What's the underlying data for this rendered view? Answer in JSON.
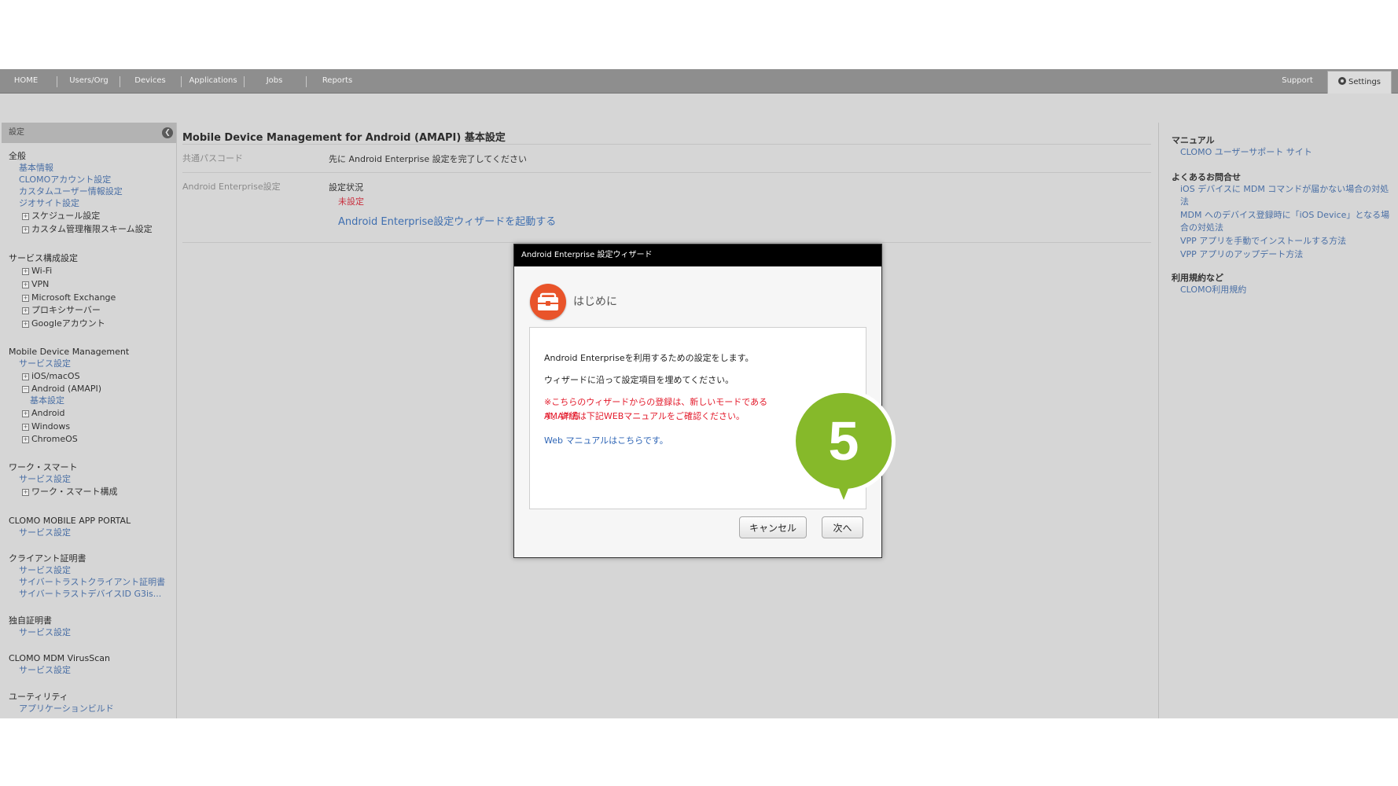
{
  "nav": {
    "items": [
      "HOME",
      "Users/Org",
      "Devices",
      "Applications",
      "Jobs",
      "Reports"
    ],
    "support": "Support",
    "settings": "Settings"
  },
  "sidebar": {
    "header": "設定",
    "sections": [
      {
        "title": "全般",
        "items": [
          {
            "label": "基本情報",
            "kind": "link"
          },
          {
            "label": "CLOMOアカウント設定",
            "kind": "link"
          },
          {
            "label": "カスタムユーザー情報設定",
            "kind": "link"
          },
          {
            "label": "ジオサイト設定",
            "kind": "link"
          },
          {
            "label": "スケジュール設定",
            "kind": "tree"
          },
          {
            "label": "カスタム管理権限スキーム設定",
            "kind": "tree"
          }
        ]
      },
      {
        "title": "サービス構成設定",
        "items": [
          {
            "label": "Wi-Fi",
            "kind": "tree"
          },
          {
            "label": "VPN",
            "kind": "tree"
          },
          {
            "label": "Microsoft Exchange",
            "kind": "tree"
          },
          {
            "label": "プロキシサーバー",
            "kind": "tree"
          },
          {
            "label": "Googleアカウント",
            "kind": "tree"
          }
        ]
      },
      {
        "title": "Mobile Device Management",
        "items": [
          {
            "label": "サービス設定",
            "kind": "link"
          },
          {
            "label": "iOS/macOS",
            "kind": "tree"
          },
          {
            "label": "Android (AMAPI)",
            "kind": "tree-open"
          },
          {
            "label": "基本設定",
            "kind": "sub"
          },
          {
            "label": "Android",
            "kind": "tree"
          },
          {
            "label": "Windows",
            "kind": "tree"
          },
          {
            "label": "ChromeOS",
            "kind": "tree"
          }
        ]
      },
      {
        "title": "ワーク・スマート",
        "items": [
          {
            "label": "サービス設定",
            "kind": "link"
          },
          {
            "label": "ワーク・スマート構成",
            "kind": "tree"
          }
        ]
      },
      {
        "title": "CLOMO MOBILE APP PORTAL",
        "items": [
          {
            "label": "サービス設定",
            "kind": "link"
          }
        ]
      },
      {
        "title": "クライアント証明書",
        "items": [
          {
            "label": "サービス設定",
            "kind": "link"
          },
          {
            "label": "サイバートラストクライアント証明書",
            "kind": "link"
          },
          {
            "label": "サイバートラストデバイスID G3is...",
            "kind": "link"
          }
        ]
      },
      {
        "title": "独自証明書",
        "items": [
          {
            "label": "サービス設定",
            "kind": "link"
          }
        ]
      },
      {
        "title": "CLOMO MDM VirusScan",
        "items": [
          {
            "label": "サービス設定",
            "kind": "link"
          }
        ]
      },
      {
        "title": "ユーティリティ",
        "items": [
          {
            "label": "アプリケーションビルド",
            "kind": "link"
          }
        ]
      }
    ]
  },
  "main": {
    "title": "Mobile Device Management for Android (AMAPI) 基本設定",
    "passcode_label": "共通パスコード",
    "passcode_value": "先に Android Enterprise 設定を完了してください",
    "ae_label": "Android Enterprise設定",
    "status_label": "設定状況",
    "status_value": "未設定",
    "wizard_link": "Android Enterprise設定ウィザードを起動する"
  },
  "right": {
    "manual_title": "マニュアル",
    "manual_link": "CLOMO ユーザーサポート サイト",
    "faq_title": "よくあるお問合せ",
    "faq_links": [
      "iOS デバイスに MDM コマンドが届かない場合の対処法",
      "MDM へのデバイス登録時に「iOS Device」となる場合の対処法",
      "VPP アプリを手動でインストールする方法",
      "VPP アプリのアップデート方法"
    ],
    "terms_title": "利用規約など",
    "terms_link": "CLOMO利用規約"
  },
  "modal": {
    "title": "Android Enterprise 設定ウィザード",
    "heading": "はじめに",
    "line1": "Android Enterpriseを利用するための設定をします。",
    "line2": "ウィザードに沿って設定項目を埋めてください。",
    "warning1": "※こちらのウィザードからの登録は、新しいモードであるAMAPI方",
    "warning2": "す。詳細は下記WEBマニュアルをご確認ください。",
    "manual_link": "Web マニュアルはこちらです。",
    "cancel": "キャンセル",
    "next": "次へ"
  },
  "callout": {
    "number": "5",
    "color": "#86b92a"
  },
  "colors": {
    "nav": "#8e8e8e",
    "link": "#4a6fa5",
    "warning": "#e3192a",
    "icon": "#e9542a"
  }
}
